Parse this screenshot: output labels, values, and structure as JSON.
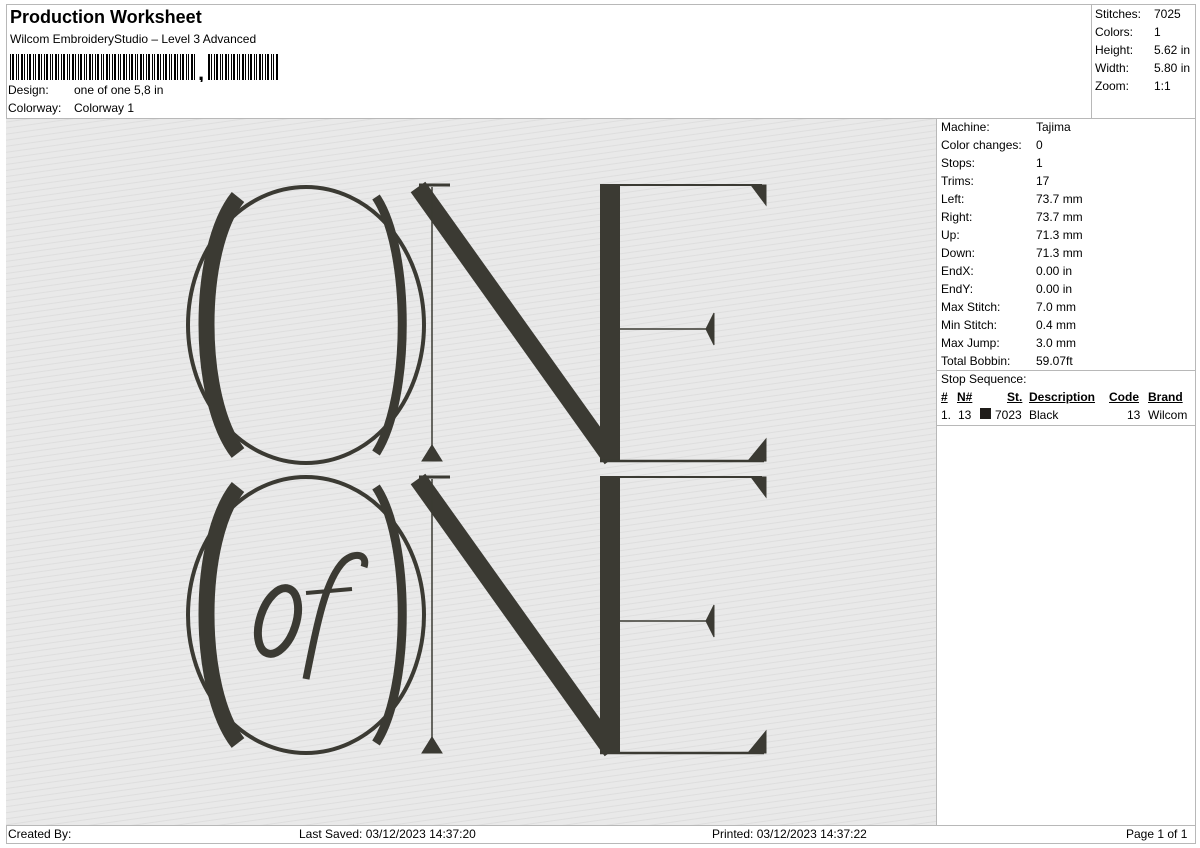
{
  "header": {
    "title": "Production Worksheet",
    "subtitle": "Wilcom EmbroideryStudio – Level 3 Advanced",
    "design_label": "Design:",
    "design_value": "one of one 5,8 in",
    "colorway_label": "Colorway:",
    "colorway_value": "Colorway 1"
  },
  "stats": {
    "stitches_label": "Stitches:",
    "stitches_value": "7025",
    "colors_label": "Colors:",
    "colors_value": "1",
    "height_label": "Height:",
    "height_value": "5.62 in",
    "width_label": "Width:",
    "width_value": "5.80 in",
    "zoom_label": "Zoom:",
    "zoom_value": "1:1"
  },
  "machine": [
    {
      "label": "Machine:",
      "value": "Tajima"
    },
    {
      "label": "Color changes:",
      "value": "0"
    },
    {
      "label": "Stops:",
      "value": "1"
    },
    {
      "label": "Trims:",
      "value": "17"
    },
    {
      "label": "Left:",
      "value": "73.7 mm"
    },
    {
      "label": "Right:",
      "value": "73.7 mm"
    },
    {
      "label": "Up:",
      "value": "71.3 mm"
    },
    {
      "label": "Down:",
      "value": "71.3 mm"
    },
    {
      "label": "EndX:",
      "value": "0.00 in"
    },
    {
      "label": "EndY:",
      "value": "0.00 in"
    },
    {
      "label": "Max Stitch:",
      "value": "7.0 mm"
    },
    {
      "label": "Min Stitch:",
      "value": "0.4 mm"
    },
    {
      "label": "Max Jump:",
      "value": "3.0 mm"
    },
    {
      "label": "Total Bobbin:",
      "value": "59.07ft"
    }
  ],
  "stop_sequence": {
    "title": "Stop Sequence:",
    "headers": [
      "#",
      "N#",
      "St.",
      "Description",
      "Code",
      "Brand"
    ],
    "rows": [
      {
        "num": "1.",
        "n": "13",
        "st": "7023",
        "description": "Black",
        "code": "13",
        "brand": "Wilcom",
        "swatch_color": "#1f1c19"
      }
    ]
  },
  "footer": {
    "created_by": "Created By:",
    "last_saved": "Last Saved: 03/12/2023 14:37:20",
    "printed": "Printed: 03/12/2023 14:37:22",
    "page": "Page 1 of 1"
  },
  "design_preview": {
    "words": [
      "O",
      "N",
      "E",
      "of",
      "O",
      "N",
      "E"
    ],
    "thread_color": "#3b3a33",
    "background": "#e9e9e9"
  }
}
